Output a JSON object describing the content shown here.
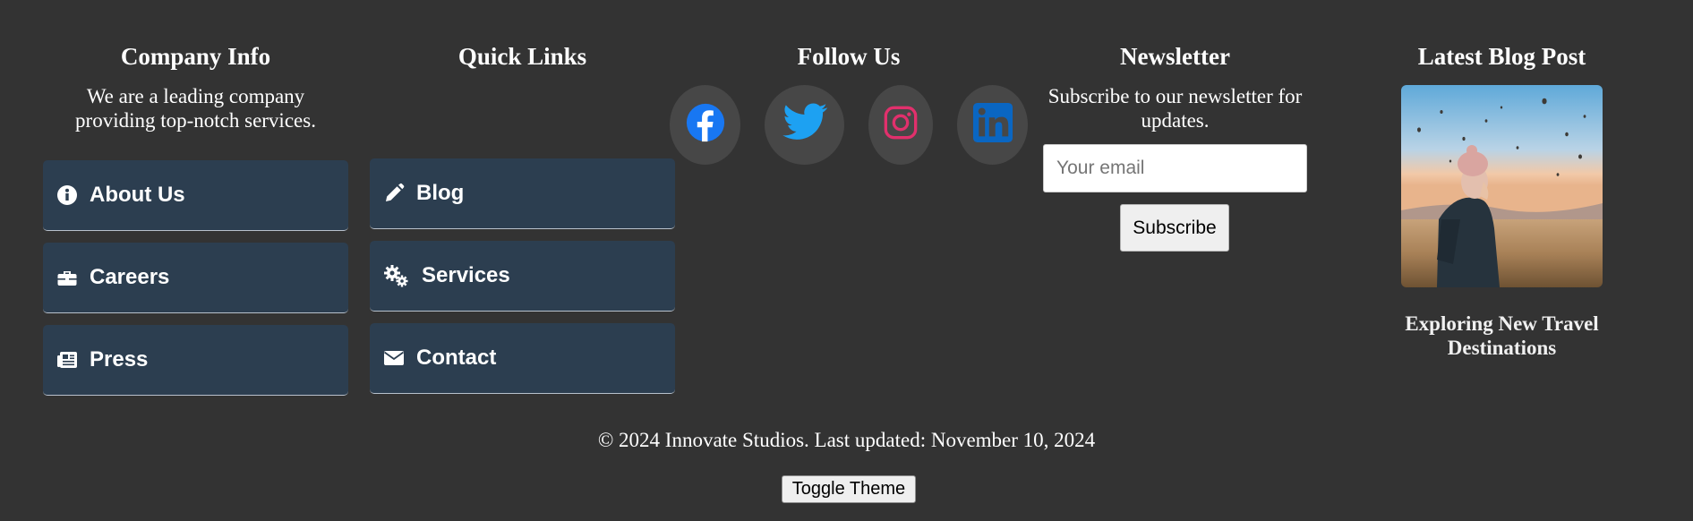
{
  "company_info": {
    "heading": "Company Info",
    "description": "We are a leading company providing top-notch services.",
    "links": [
      {
        "label": "About Us",
        "icon": "info-circle-icon"
      },
      {
        "label": "Careers",
        "icon": "briefcase-icon"
      },
      {
        "label": "Press",
        "icon": "newspaper-icon"
      }
    ]
  },
  "quick_links": {
    "heading": "Quick Links",
    "links": [
      {
        "label": "Blog",
        "icon": "pencil-icon"
      },
      {
        "label": "Services",
        "icon": "gears-icon"
      },
      {
        "label": "Contact",
        "icon": "envelope-icon"
      }
    ]
  },
  "follow_us": {
    "heading": "Follow Us",
    "networks": [
      {
        "name": "facebook",
        "icon": "facebook-icon",
        "color": "#1877f2"
      },
      {
        "name": "twitter",
        "icon": "twitter-icon",
        "color": "#1da1f2"
      },
      {
        "name": "instagram",
        "icon": "instagram-icon",
        "color": "#e1306c"
      },
      {
        "name": "linkedin",
        "icon": "linkedin-icon",
        "color": "#0a66c2"
      }
    ]
  },
  "newsletter": {
    "heading": "Newsletter",
    "description": "Subscribe to our newsletter for updates.",
    "email_placeholder": "Your email",
    "email_value": "",
    "subscribe_label": "Subscribe"
  },
  "blog": {
    "heading": "Latest Blog Post",
    "image": "hot-air-balloon-travel-photo",
    "title": "Exploring New Travel Destinations"
  },
  "footer": {
    "copyright": "© 2024 Innovate Studios. Last updated: November 10, 2024",
    "toggle_label": "Toggle Theme"
  },
  "colors": {
    "background": "#333333",
    "link_button": "#2c3e50",
    "social_circle": "#474747"
  }
}
